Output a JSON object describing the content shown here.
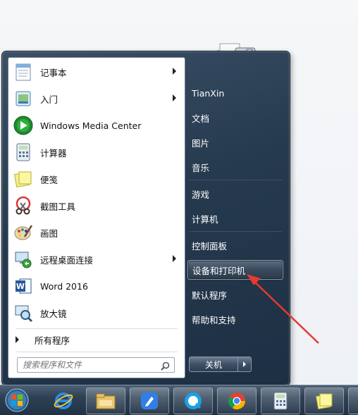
{
  "programs": [
    {
      "label": "记事本",
      "icon": "notepad-icon",
      "submenu": true
    },
    {
      "label": "入门",
      "icon": "getting-started-icon",
      "submenu": true
    },
    {
      "label": "Windows Media Center",
      "icon": "media-center-icon",
      "submenu": false
    },
    {
      "label": "计算器",
      "icon": "calculator-icon",
      "submenu": false
    },
    {
      "label": "便笺",
      "icon": "sticky-notes-icon",
      "submenu": false
    },
    {
      "label": "截图工具",
      "icon": "snipping-tool-icon",
      "submenu": false
    },
    {
      "label": "画图",
      "icon": "paint-icon",
      "submenu": false
    },
    {
      "label": "远程桌面连接",
      "icon": "remote-desktop-icon",
      "submenu": true
    },
    {
      "label": "Word 2016",
      "icon": "word-icon",
      "submenu": false
    },
    {
      "label": "放大镜",
      "icon": "magnifier-icon",
      "submenu": false
    }
  ],
  "all_programs_label": "所有程序",
  "search": {
    "placeholder": "搜索程序和文件"
  },
  "right_items": [
    {
      "label": "TianXin"
    },
    {
      "label": "文档"
    },
    {
      "label": "图片"
    },
    {
      "label": "音乐"
    },
    {
      "label": "游戏"
    },
    {
      "label": "计算机"
    },
    {
      "label": "控制面板"
    },
    {
      "label": "设备和打印机"
    },
    {
      "label": "默认程序"
    },
    {
      "label": "帮助和支持"
    }
  ],
  "highlighted_item": "设备和打印机",
  "shutdown_label": "关机",
  "taskbar_items": [
    "start-orb-icon",
    "internet-explorer-icon",
    "file-explorer-icon",
    "pen-app-icon",
    "qq-browser-icon",
    "chrome-icon",
    "calculator-icon",
    "sticky-notes-icon"
  ],
  "colors": {
    "accent_red": "#e53a2f",
    "menu_dark": "#263a4f"
  }
}
